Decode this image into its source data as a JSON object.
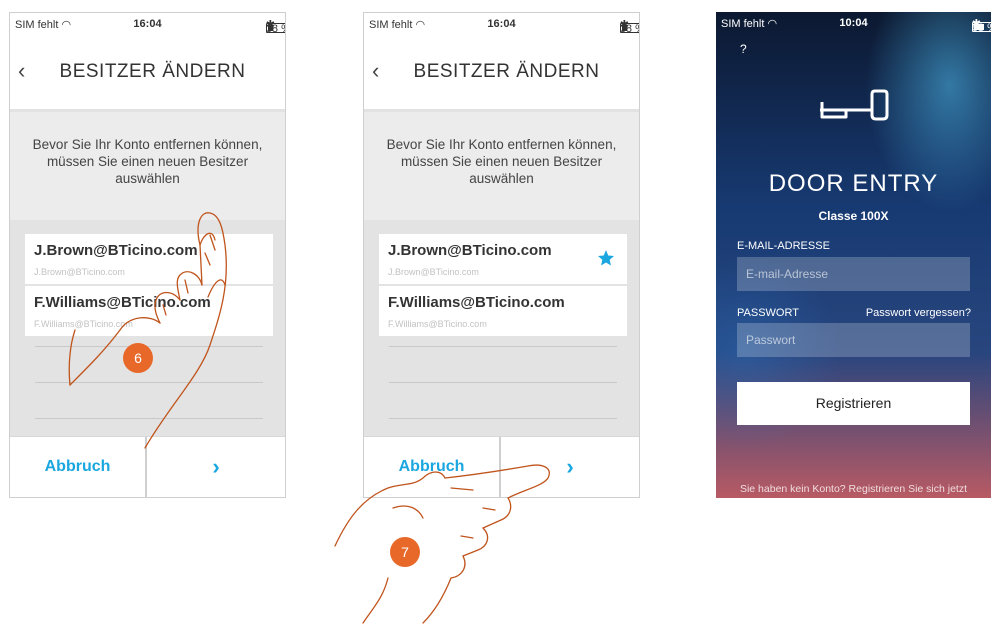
{
  "status_bar_light": {
    "carrier": "SIM fehlt",
    "time": "16:04",
    "battery": "38 %"
  },
  "status_bar_dark": {
    "carrier": "SIM fehlt",
    "time": "10:04",
    "battery": "63 %"
  },
  "screen1": {
    "title": "BESITZER ÄNDERN",
    "instruction": "Bevor Sie Ihr Konto entfernen können, müssen Sie einen neuen Besitzer auswählen",
    "users": [
      {
        "name": "J.Brown@BTicino.com",
        "email": "J.Brown@BTicino.com"
      },
      {
        "name": "F.Williams@BTicino.com",
        "email": "F.Williams@BTicino.com"
      }
    ],
    "cancel_label": "Abbruch",
    "next_label": "›",
    "step": "6"
  },
  "screen2": {
    "title": "BESITZER ÄNDERN",
    "instruction": "Bevor Sie Ihr Konto entfernen können, müssen Sie einen neuen Besitzer auswählen",
    "users": [
      {
        "name": "J.Brown@BTicino.com",
        "email": "J.Brown@BTicino.com",
        "selected": true
      },
      {
        "name": "F.Williams@BTicino.com",
        "email": "F.Williams@BTicino.com",
        "selected": false
      }
    ],
    "cancel_label": "Abbruch",
    "next_label": "›",
    "step": "7"
  },
  "login": {
    "help": "?",
    "app_title": "DOOR ENTRY",
    "app_subtitle": "Classe 100X",
    "email_label": "E-MAIL-ADRESSE",
    "email_placeholder": "E-mail-Adresse",
    "password_label": "PASSWORT",
    "forgot_password": "Passwort vergessen?",
    "password_placeholder": "Passwort",
    "register_button": "Registrieren",
    "signup_prompt": "Sie haben kein Konto? Registrieren Sie sich jetzt"
  },
  "colors": {
    "accent": "#1aa7e0",
    "step_badge": "#e8682a"
  },
  "icons": {
    "back": "chevron-left-icon",
    "selected": "star-icon",
    "next": "chevron-right-icon",
    "logo": "key-icon"
  }
}
